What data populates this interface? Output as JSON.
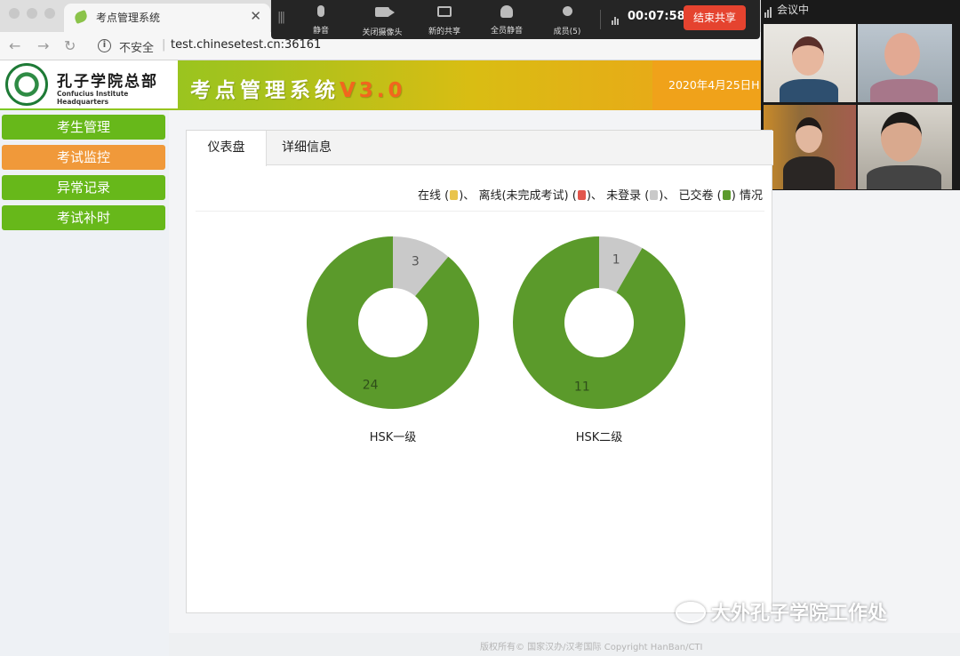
{
  "browser": {
    "tab_title": "考点管理系统",
    "security_label": "不安全",
    "url": "test.chinesetest.cn:36161"
  },
  "zoom_toolbar": {
    "items": [
      "静音",
      "关闭摄像头",
      "新的共享",
      "全员静音",
      "成员(5)"
    ],
    "timer": "00:07:58",
    "end_share_label": "结束共享",
    "end_share_color": "#e5432f"
  },
  "video_panel": {
    "label": "会议中"
  },
  "header": {
    "logo_cn": "孔子学院总部",
    "logo_en": "Confucius Institute Headquarters",
    "system_title": "考点管理系统",
    "version": "V3.0",
    "date": "2020年4月25日H"
  },
  "sidebar": {
    "items": [
      {
        "label": "考生管理",
        "color": "#67b81a"
      },
      {
        "label": "考试监控",
        "color": "#f0993a"
      },
      {
        "label": "异常记录",
        "color": "#67b81a"
      },
      {
        "label": "考试补时",
        "color": "#67b81a"
      }
    ]
  },
  "main": {
    "tabs": [
      "仪表盘",
      "详细信息"
    ],
    "legend": {
      "online": "在线",
      "offline": "离线(未完成考试)",
      "not_logged": "未登录",
      "submitted": "已交卷",
      "suffix": "情况",
      "sep": "、",
      "colors": {
        "online": "#e9c44c",
        "offline": "#e2564c",
        "not_logged": "#c9c9c9",
        "submitted": "#5b9a2b"
      }
    }
  },
  "chart_data": [
    {
      "type": "pie",
      "title": "HSK一级",
      "slices": [
        {
          "name": "已交卷",
          "value": 24,
          "color": "#5b9a2b"
        },
        {
          "name": "未登录",
          "value": 3,
          "color": "#c9c9c9"
        }
      ]
    },
    {
      "type": "pie",
      "title": "HSK二级",
      "slices": [
        {
          "name": "已交卷",
          "value": 11,
          "color": "#5b9a2b"
        },
        {
          "name": "未登录",
          "value": 1,
          "color": "#c9c9c9"
        }
      ]
    }
  ],
  "footer": {
    "copyright": "版权所有© 国家汉办/汉考国际 Copyright HanBan/CTI"
  },
  "watermark": {
    "text": "大外孔子学院工作处"
  }
}
